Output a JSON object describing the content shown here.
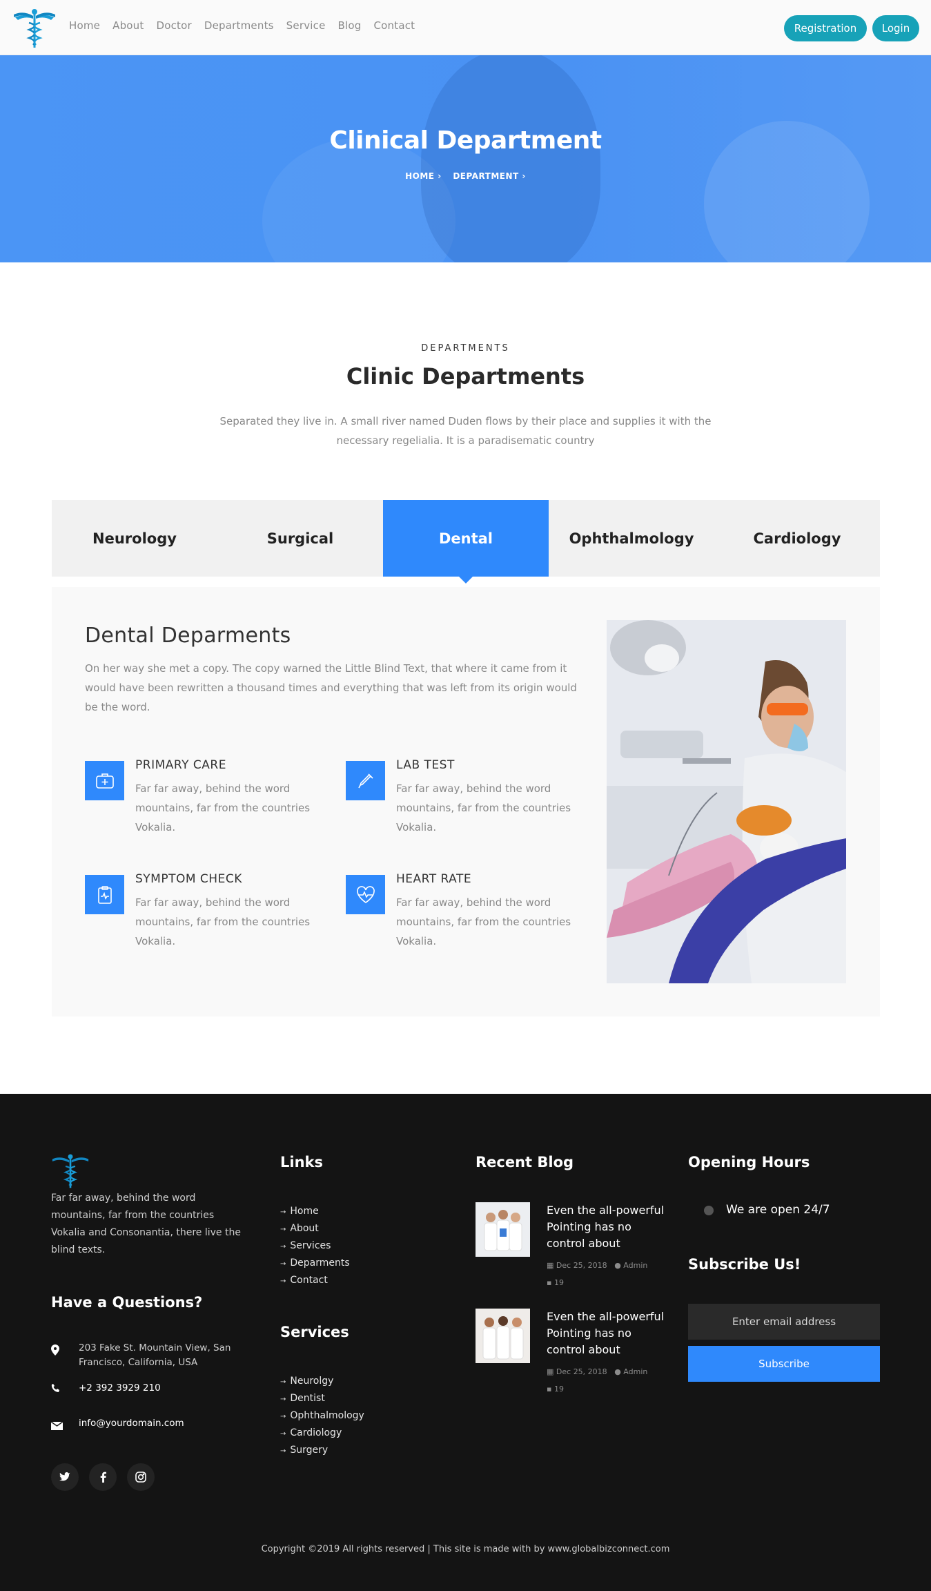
{
  "nav": {
    "links": [
      "Home",
      "About",
      "Doctor",
      "Departments",
      "Service",
      "Blog",
      "Contact"
    ],
    "registration": "Registration",
    "login": "Login"
  },
  "hero": {
    "title": "Clinical Department",
    "crumb_home": "HOME",
    "crumb_department": "DEPARTMENT"
  },
  "section": {
    "subheading": "DEPARTMENTS",
    "heading": "Clinic Departments",
    "intro": "Separated they live in. A small river named Duden flows by their place and supplies it with the necessary regelialia. It is a paradisematic country"
  },
  "tabs": [
    "Neurology",
    "Surgical",
    "Dental",
    "Ophthalmology",
    "Cardiology"
  ],
  "active_tab": "Dental",
  "panel": {
    "title": "Dental Deparments",
    "text": "On her way she met a copy. The copy warned the Little Blind Text, that where it came from it would have been rewritten a thousand times and everything that was left from its origin would be the word.",
    "features": [
      {
        "title": "PRIMARY CARE",
        "text": "Far far away, behind the word mountains, far from the countries Vokalia.",
        "icon": "first-aid-kit-icon"
      },
      {
        "title": "LAB TEST",
        "text": "Far far away, behind the word mountains, far from the countries Vokalia.",
        "icon": "dropper-icon"
      },
      {
        "title": "SYMPTOM CHECK",
        "text": "Far far away, behind the word mountains, far from the countries Vokalia.",
        "icon": "clipboard-icon"
      },
      {
        "title": "HEART RATE",
        "text": "Far far away, behind the word mountains, far from the countries Vokalia.",
        "icon": "heart-rate-icon"
      }
    ]
  },
  "footer": {
    "about": "Far far away, behind the word mountains, far from the countries Vokalia and Consonantia, there live the blind texts.",
    "questions_heading": "Have a Questions?",
    "address": "203 Fake St. Mountain View, San Francisco, California, USA",
    "phone": "+2 392 3929 210",
    "email": "info@yourdomain.com",
    "links_heading": "Links",
    "links": [
      "Home",
      "About",
      "Services",
      "Deparments",
      "Contact"
    ],
    "services_heading": "Services",
    "services": [
      "Neurolgy",
      "Dentist",
      "Ophthalmology",
      "Cardiology",
      "Surgery"
    ],
    "blog_heading": "Recent Blog",
    "blog": [
      {
        "title": "Even the all-powerful Pointing has no control about",
        "date": "Dec 25, 2018",
        "author": "Admin",
        "comments": "19"
      },
      {
        "title": "Even the all-powerful Pointing has no control about",
        "date": "Dec 25, 2018",
        "author": "Admin",
        "comments": "19"
      }
    ],
    "hours_heading": "Opening Hours",
    "hours_text": "We are open 24/7",
    "subscribe_heading": "Subscribe Us!",
    "subscribe_placeholder": "Enter email address",
    "subscribe_button": "Subscribe",
    "copyright": "Copyright ©2019 All rights reserved | This site is made with by www.globalbizconnect.com"
  },
  "colors": {
    "accent": "#2f89fc",
    "teal": "#17a2b8",
    "footer_bg": "#141414",
    "hero": "#4a92f3"
  }
}
